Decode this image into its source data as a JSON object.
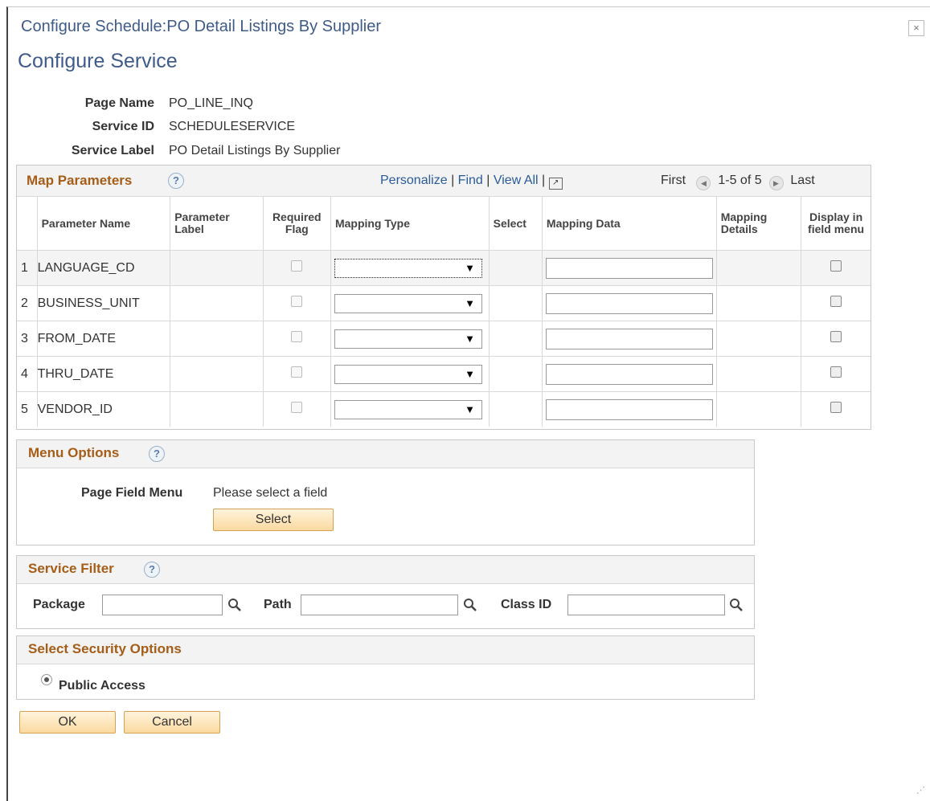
{
  "modal": {
    "title": "Configure Schedule:PO Detail Listings By Supplier",
    "close": "×"
  },
  "page": {
    "title": "Configure Service"
  },
  "info": {
    "page_name_label": "Page Name",
    "page_name_value": "PO_LINE_INQ",
    "service_id_label": "Service ID",
    "service_id_value": "SCHEDULESERVICE",
    "service_label_label": "Service Label",
    "service_label_value": "PO Detail Listings By Supplier"
  },
  "map_params": {
    "title": "Map Parameters",
    "help": "?",
    "personalize": "Personalize",
    "find": "Find",
    "view_all": "View All",
    "sep": "|",
    "first": "First",
    "range": "1-5 of 5",
    "last": "Last",
    "columns": {
      "param_name": "Parameter Name",
      "param_label": "Parameter Label",
      "required": "Required Flag",
      "mapping_type": "Mapping Type",
      "select": "Select",
      "mapping_data": "Mapping Data",
      "mapping_details": "Mapping Details",
      "display_menu": "Display in field menu"
    },
    "rows": [
      {
        "num": "1",
        "name": "LANGUAGE_CD"
      },
      {
        "num": "2",
        "name": "BUSINESS_UNIT"
      },
      {
        "num": "3",
        "name": "FROM_DATE"
      },
      {
        "num": "4",
        "name": "THRU_DATE"
      },
      {
        "num": "5",
        "name": "VENDOR_ID"
      }
    ]
  },
  "menu_options": {
    "title": "Menu Options",
    "help": "?",
    "field_label": "Page Field Menu",
    "field_value": "Please select a field",
    "select_button": "Select"
  },
  "service_filter": {
    "title": "Service Filter",
    "help": "?",
    "package_label": "Package",
    "path_label": "Path",
    "class_label": "Class ID"
  },
  "security": {
    "title": "Select Security Options",
    "public_access": "Public Access"
  },
  "actions": {
    "ok": "OK",
    "cancel": "Cancel"
  },
  "icons": {
    "search": "search-icon",
    "popout": "popout-icon",
    "prev": "previous-arrow-icon",
    "next": "next-arrow-icon"
  }
}
